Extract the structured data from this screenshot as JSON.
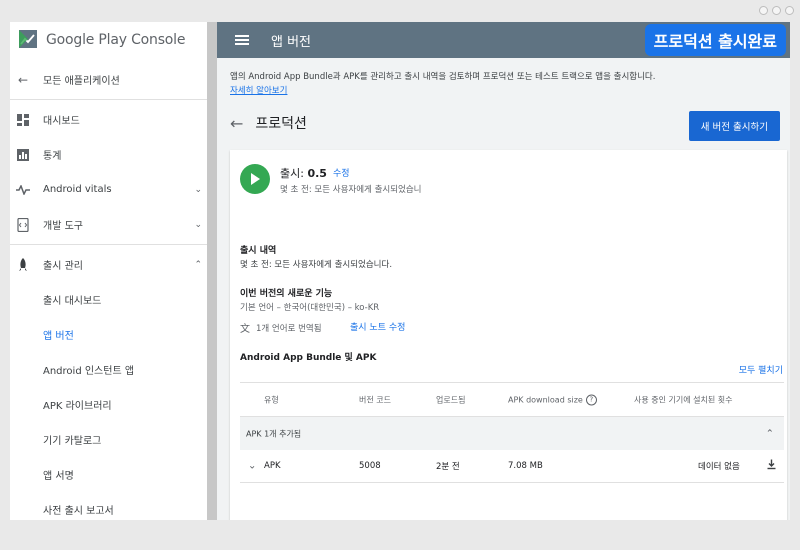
{
  "brand": {
    "google": "Google Play",
    "console": "Console"
  },
  "badge": "프로덕션 출시완료",
  "sidebar": {
    "items": [
      {
        "label": "모든 애플리케이션"
      },
      {
        "label": "대시보드"
      },
      {
        "label": "통계"
      },
      {
        "label": "Android vitals"
      },
      {
        "label": "개발 도구"
      },
      {
        "label": "출시 관리"
      },
      {
        "label": "출시 대시보드"
      },
      {
        "label": "앱 버전"
      },
      {
        "label": "Android 인스턴트 앱"
      },
      {
        "label": "APK 라이브러리"
      },
      {
        "label": "기기 카탈로그"
      },
      {
        "label": "앱 서명"
      },
      {
        "label": "사전 출시 보고서"
      }
    ]
  },
  "topbar": {
    "title": "앱 버전"
  },
  "main": {
    "description": "앱의 Android App Bundle과 APK를 관리하고 출시 내역을 검토하며 프로덕션 또는 테스트 트랙으로 앱을 출시합니다.",
    "learn_more": "자세히 알아보기",
    "page_title": "프로덕션",
    "new_release_button": "새 버전 출시하기"
  },
  "release": {
    "title_prefix": "출시: ",
    "version": "0.5",
    "edit": "수정",
    "subtitle": "몇 초 전: 모든 사용자에게 출시되었습니",
    "history_label": "출시 내역",
    "history_text": "몇 초 전: 모든 사용자에게 출시되었습니다.",
    "whats_new_label": "이번 버전의 새로운 기능",
    "whats_new_text": "기본 언어 – 한국어(대한민국) – ko-KR",
    "translated": "1개 언어로 번역됨",
    "edit_notes": "출시 노트 수정",
    "bundle_label": "Android App Bundle 및 APK",
    "expand_all": "모두 펼치기"
  },
  "table": {
    "headers": {
      "type": "유형",
      "version_code": "버전 코드",
      "uploaded": "업로드됨",
      "download_size": "APK download size",
      "installs": "사용 중인 기기에 설치된 횟수"
    },
    "group": "APK 1개 추가됨",
    "rows": [
      {
        "type": "APK",
        "version_code": "5008",
        "uploaded": "2분 전",
        "size": "7.08 MB",
        "installs": "데이터 없음"
      }
    ]
  }
}
